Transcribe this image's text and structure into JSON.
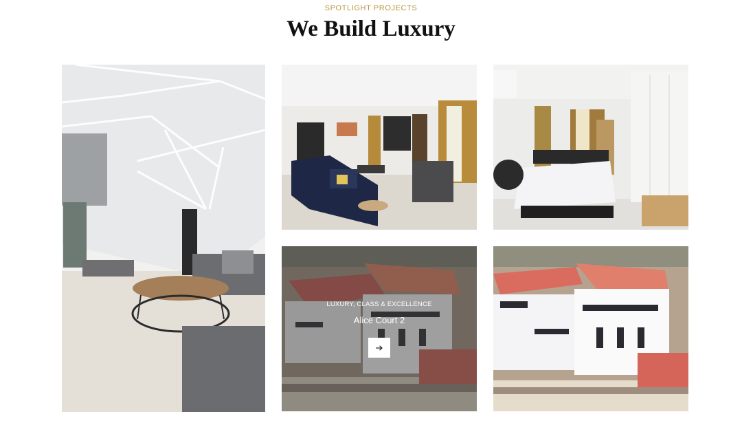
{
  "section": {
    "eyebrow": "SPOTLIGHT PROJECTS",
    "title": "We Build Luxury"
  },
  "projects": [
    {
      "image": "living-room-ceiling-lights"
    },
    {
      "image": "living-room-sofa-tv"
    },
    {
      "image": "bedroom-wardrobe"
    },
    {
      "image": "alice-court-aerial",
      "overlay": {
        "tag": "LUXURY, CLASS & EXCELLENCE",
        "name": "Alice Court 2",
        "button_icon": "arrow-right-icon"
      }
    },
    {
      "image": "apartment-aerial"
    }
  ],
  "colors": {
    "accent": "#b8963e",
    "heading": "#111111",
    "overlay": "rgba(60,60,60,0.45)"
  }
}
